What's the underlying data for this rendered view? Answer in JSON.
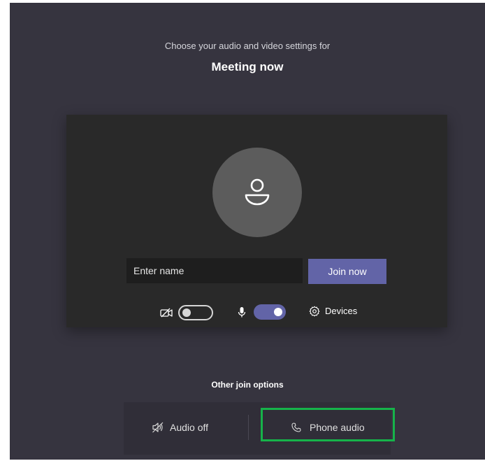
{
  "header": {
    "subtitle": "Choose your audio and video settings for",
    "meeting_title": "Meeting now"
  },
  "preview": {
    "name_placeholder": "Enter name",
    "name_value": "",
    "join_label": "Join now",
    "camera_toggle": "off",
    "mic_toggle": "on",
    "devices_label": "Devices"
  },
  "other_options": {
    "heading": "Other join options",
    "audio_off_label": "Audio off",
    "phone_audio_label": "Phone audio"
  },
  "colors": {
    "background": "#36343f",
    "panel": "#292929",
    "accent": "#6264a7",
    "highlight": "#16b34a"
  },
  "icons": {
    "camera": "camera-off-icon",
    "mic": "microphone-icon",
    "devices": "gear-icon",
    "audio_off": "speaker-off-icon",
    "phone": "phone-icon",
    "avatar": "person-icon"
  }
}
